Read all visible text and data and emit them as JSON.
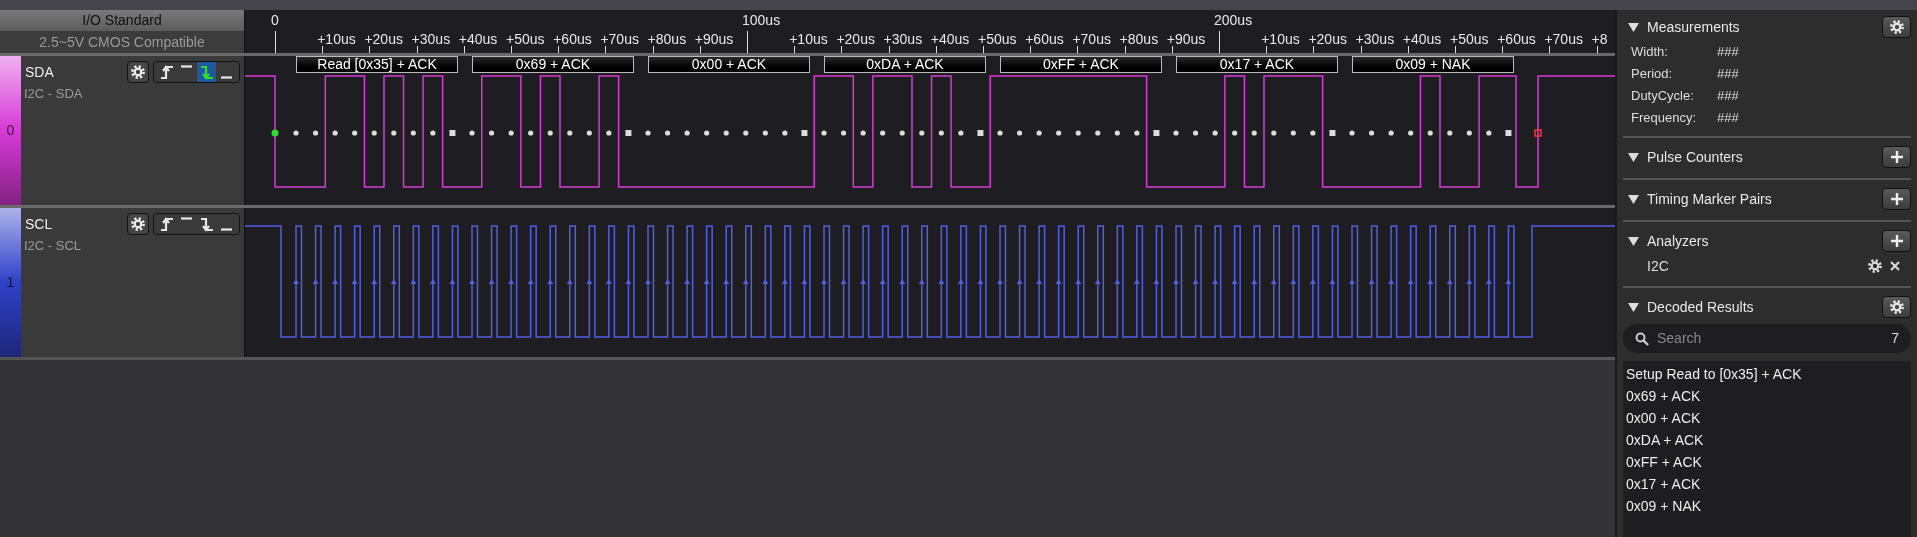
{
  "io_standard": {
    "title": "I/O Standard",
    "value": "2.5~5V CMOS Compatible"
  },
  "ruler": [
    {
      "label": "0",
      "kind": "major"
    },
    {
      "label": "+10us",
      "kind": "minor"
    },
    {
      "label": "+20us",
      "kind": "minor"
    },
    {
      "label": "+30us",
      "kind": "minor"
    },
    {
      "label": "+40us",
      "kind": "minor"
    },
    {
      "label": "+50us",
      "kind": "minor"
    },
    {
      "label": "+60us",
      "kind": "minor"
    },
    {
      "label": "+70us",
      "kind": "minor"
    },
    {
      "label": "+80us",
      "kind": "minor"
    },
    {
      "label": "+90us",
      "kind": "minor"
    },
    {
      "label": "100us",
      "kind": "major"
    },
    {
      "label": "+10us",
      "kind": "minor"
    },
    {
      "label": "+20us",
      "kind": "minor"
    },
    {
      "label": "+30us",
      "kind": "minor"
    },
    {
      "label": "+40us",
      "kind": "minor"
    },
    {
      "label": "+50us",
      "kind": "minor"
    },
    {
      "label": "+60us",
      "kind": "minor"
    },
    {
      "label": "+70us",
      "kind": "minor"
    },
    {
      "label": "+80us",
      "kind": "minor"
    },
    {
      "label": "+90us",
      "kind": "minor"
    },
    {
      "label": "200us",
      "kind": "major"
    },
    {
      "label": "+10us",
      "kind": "minor"
    },
    {
      "label": "+20us",
      "kind": "minor"
    },
    {
      "label": "+30us",
      "kind": "minor"
    },
    {
      "label": "+40us",
      "kind": "minor"
    },
    {
      "label": "+50us",
      "kind": "minor"
    },
    {
      "label": "+60us",
      "kind": "minor"
    },
    {
      "label": "+70us",
      "kind": "minor"
    },
    {
      "label": "+8",
      "kind": "minor"
    }
  ],
  "channels": [
    {
      "index": "0",
      "name": "SDA",
      "label": "I2C - SDA",
      "color": "#d63ad6",
      "kind": "data",
      "triggers": [
        {
          "kind": "rising",
          "selected": false
        },
        {
          "kind": "high",
          "selected": false
        },
        {
          "kind": "falling",
          "selected": true
        },
        {
          "kind": "low",
          "selected": false
        }
      ]
    },
    {
      "index": "1",
      "name": "SCL",
      "label": "I2C - SCL",
      "color": "#3040c8",
      "kind": "clock",
      "triggers": [
        {
          "kind": "rising",
          "selected": false
        },
        {
          "kind": "high",
          "selected": false
        },
        {
          "kind": "falling",
          "selected": false
        },
        {
          "kind": "low",
          "selected": false
        }
      ]
    }
  ],
  "decoded_bubbles": [
    "Read [0x35] + ACK",
    "0x69 + ACK",
    "0x00 + ACK",
    "0xDA + ACK",
    "0xFF + ACK",
    "0x17 + ACK",
    "0x09 + NAK"
  ],
  "side_panel": [
    {
      "kind": "measurements",
      "title": "Measurements",
      "rows": [
        {
          "label": "Width:",
          "value": "###"
        },
        {
          "label": "Period:",
          "value": "###"
        },
        {
          "label": "DutyCycle:",
          "value": "###"
        },
        {
          "label": "Frequency:",
          "value": "###"
        }
      ]
    },
    {
      "kind": "pulse_counters",
      "title": "Pulse Counters"
    },
    {
      "kind": "timing_marker_pairs",
      "title": "Timing Marker Pairs"
    },
    {
      "kind": "analyzers",
      "title": "Analyzers",
      "items": [
        "I2C"
      ]
    },
    {
      "kind": "decoded_results",
      "title": "Decoded Results",
      "search": {
        "placeholder": "Search",
        "count": "7"
      },
      "results": [
        "Setup Read to [0x35] + ACK",
        "0x69 + ACK",
        "0x00 + ACK",
        "0xDA + ACK",
        "0xFF + ACK",
        "0x17 + ACK",
        "0x09 + NAK"
      ]
    }
  ]
}
